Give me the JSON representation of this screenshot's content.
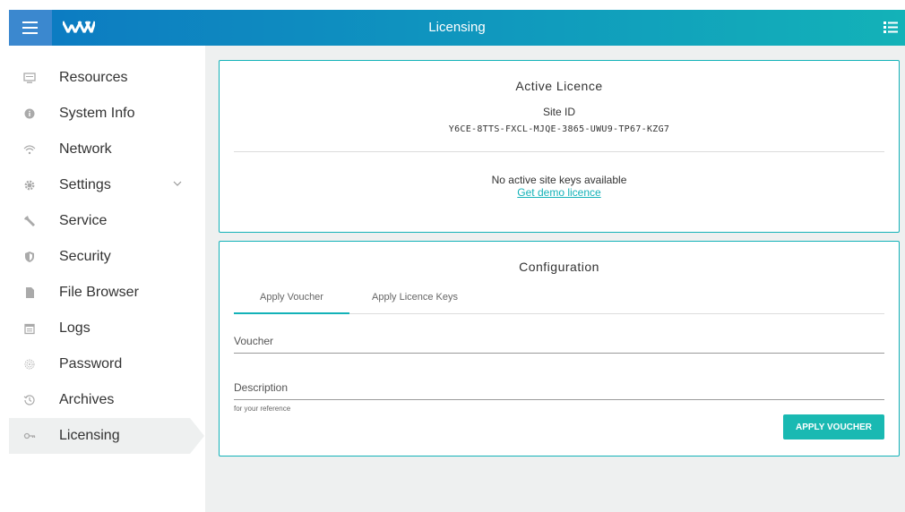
{
  "topbar": {
    "title": "Licensing",
    "colors": {
      "start": "#0c79c2",
      "end": "#13b2b8",
      "menu_bg": "#3b88cf"
    }
  },
  "sidebar": {
    "items": [
      {
        "label": "Resources",
        "icon": "monitor-icon"
      },
      {
        "label": "System Info",
        "icon": "info-icon"
      },
      {
        "label": "Network",
        "icon": "wifi-icon"
      },
      {
        "label": "Settings",
        "icon": "gear-icon"
      },
      {
        "label": "Service",
        "icon": "wrench-icon"
      },
      {
        "label": "Security",
        "icon": "shield-icon"
      },
      {
        "label": "File Browser",
        "icon": "file-icon"
      },
      {
        "label": "Logs",
        "icon": "calendar-icon"
      },
      {
        "label": "Password",
        "icon": "fingerprint-icon"
      },
      {
        "label": "Archives",
        "icon": "history-icon"
      },
      {
        "label": "Licensing",
        "icon": "key-icon",
        "active": true
      }
    ]
  },
  "active_licence": {
    "title": "Active Licence",
    "site_id_label": "Site ID",
    "site_id": "Y6CE-8TTS-FXCL-MJQE-3865-UWU9-TP67-KZG7",
    "no_keys_text": "No active site keys available",
    "demo_link": "Get demo licence"
  },
  "configuration": {
    "title": "Configuration",
    "tabs": [
      {
        "label": "Apply Voucher",
        "active": true
      },
      {
        "label": "Apply Licence Keys",
        "active": false
      }
    ],
    "voucher_label": "Voucher",
    "voucher_value": "",
    "description_label": "Description",
    "description_value": "",
    "description_hint": "for your reference",
    "apply_button": "APPLY VOUCHER"
  },
  "colors": {
    "accent": "#13b2b8",
    "button": "#19b9b2",
    "content_bg": "#eef0f0"
  }
}
